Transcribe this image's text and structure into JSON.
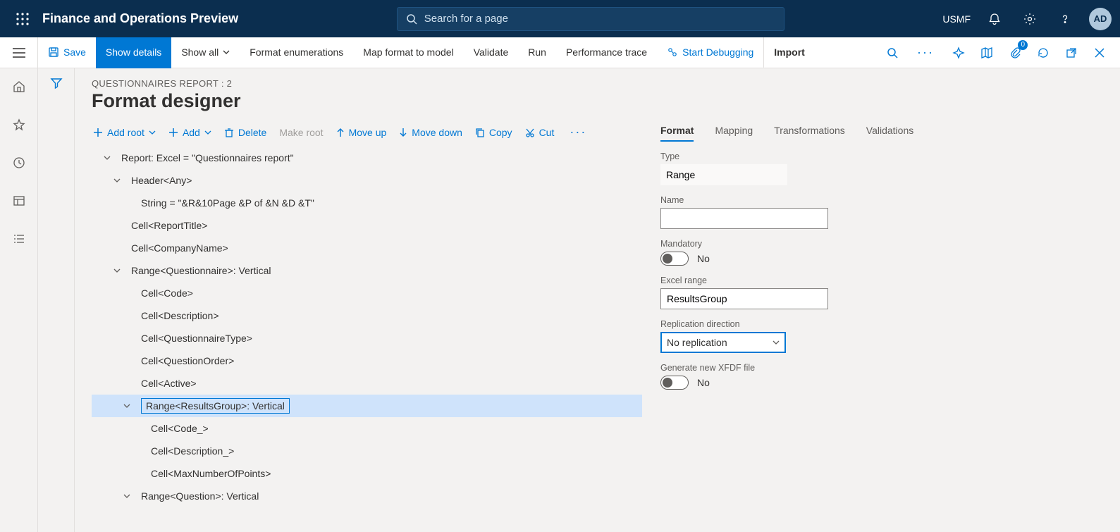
{
  "topnav": {
    "app_title": "Finance and Operations Preview",
    "search_placeholder": "Search for a page",
    "company": "USMF",
    "avatar": "AD"
  },
  "cmdbar": {
    "save": "Save",
    "show_details": "Show details",
    "show_all": "Show all",
    "format_enum": "Format enumerations",
    "map_format": "Map format to model",
    "validate": "Validate",
    "run": "Run",
    "perf_trace": "Performance trace",
    "start_debug": "Start Debugging",
    "import": "Import",
    "attach_badge": "0"
  },
  "page": {
    "crumb": "QUESTIONNAIRES REPORT : 2",
    "title": "Format designer"
  },
  "treebar": {
    "add_root": "Add root",
    "add": "Add",
    "delete": "Delete",
    "make_root": "Make root",
    "move_up": "Move up",
    "move_down": "Move down",
    "copy": "Copy",
    "cut": "Cut"
  },
  "tree": [
    {
      "depth": 0,
      "caret": "down",
      "label": "Report: Excel = \"Questionnaires report\""
    },
    {
      "depth": 1,
      "caret": "down",
      "label": "Header<Any>"
    },
    {
      "depth": 2,
      "caret": "none",
      "label": "String = \"&R&10Page &P of &N &D &T\""
    },
    {
      "depth": 1,
      "caret": "none",
      "label": "Cell<ReportTitle>"
    },
    {
      "depth": 1,
      "caret": "none",
      "label": "Cell<CompanyName>"
    },
    {
      "depth": 1,
      "caret": "down",
      "label": "Range<Questionnaire>: Vertical"
    },
    {
      "depth": 2,
      "caret": "none",
      "label": "Cell<Code>"
    },
    {
      "depth": 2,
      "caret": "none",
      "label": "Cell<Description>"
    },
    {
      "depth": 2,
      "caret": "none",
      "label": "Cell<QuestionnaireType>"
    },
    {
      "depth": 2,
      "caret": "none",
      "label": "Cell<QuestionOrder>"
    },
    {
      "depth": 2,
      "caret": "none",
      "label": "Cell<Active>"
    },
    {
      "depth": 2,
      "caret": "down",
      "label": "Range<ResultsGroup>: Vertical",
      "selected": true
    },
    {
      "depth": 3,
      "caret": "none",
      "label": "Cell<Code_>"
    },
    {
      "depth": 3,
      "caret": "none",
      "label": "Cell<Description_>"
    },
    {
      "depth": 3,
      "caret": "none",
      "label": "Cell<MaxNumberOfPoints>"
    },
    {
      "depth": 2,
      "caret": "down",
      "label": "Range<Question>: Vertical"
    }
  ],
  "rtabs": {
    "format": "Format",
    "mapping": "Mapping",
    "transformations": "Transformations",
    "validations": "Validations"
  },
  "form": {
    "type_label": "Type",
    "type_value": "Range",
    "name_label": "Name",
    "name_value": "",
    "mandatory_label": "Mandatory",
    "mandatory_text": "No",
    "excel_range_label": "Excel range",
    "excel_range_value": "ResultsGroup",
    "repl_label": "Replication direction",
    "repl_value": "No replication",
    "xfdf_label": "Generate new XFDF file",
    "xfdf_text": "No"
  }
}
